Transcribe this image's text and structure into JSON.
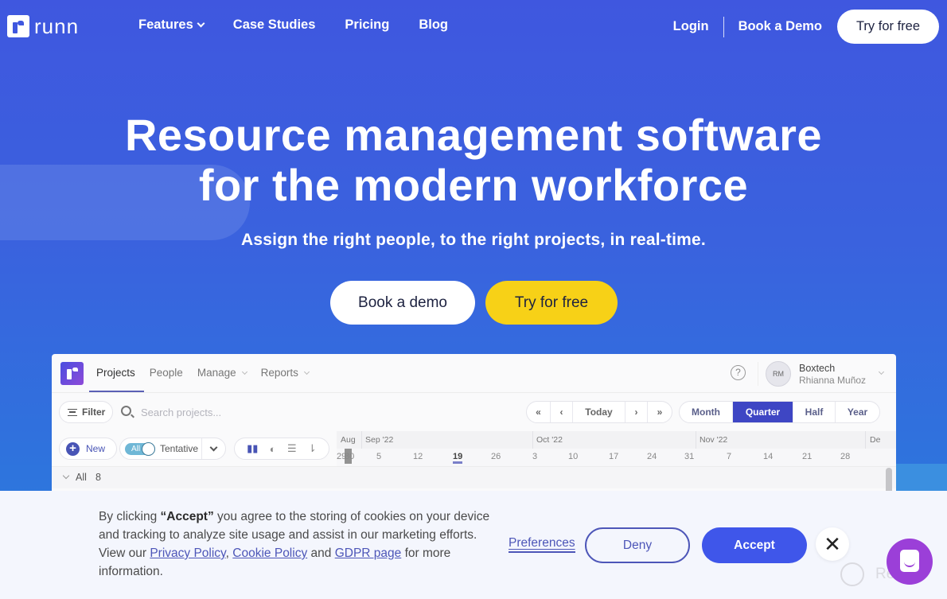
{
  "nav": {
    "logo_text": "runn",
    "links": [
      "Features",
      "Case Studies",
      "Pricing",
      "Blog"
    ],
    "login": "Login",
    "book_demo": "Book a Demo",
    "try_free": "Try for free"
  },
  "hero": {
    "title_line1": "Resource management software",
    "title_line2": "for the modern workforce",
    "subtitle": "Assign the right people, to the right projects, in real-time.",
    "cta_demo": "Book a demo",
    "cta_free": "Try for free"
  },
  "app": {
    "tabs": [
      "Projects",
      "People",
      "Manage",
      "Reports"
    ],
    "active_tab": "Projects",
    "help": "?",
    "avatar_initials": "RM",
    "org": "Boxtech",
    "user": "Rhianna Muñoz",
    "filter_label": "Filter",
    "search_placeholder": "Search projects...",
    "nav_buttons": [
      "«",
      "‹",
      "Today",
      "›",
      "»"
    ],
    "ranges": [
      "Month",
      "Quarter",
      "Half",
      "Year"
    ],
    "selected_range": "Quarter",
    "new_label": "New",
    "toggle_label": "All",
    "tentative_label": "Tentative",
    "months": [
      "Aug",
      "Sep '22",
      "Oct '22",
      "Nov '22",
      "De"
    ],
    "days": [
      "29",
      "30",
      "5",
      "12",
      "19",
      "26",
      "3",
      "10",
      "17",
      "24",
      "31",
      "7",
      "14",
      "21",
      "28"
    ],
    "today_day": "19",
    "group_label": "All",
    "group_count": "8"
  },
  "cookie": {
    "text_before": "By clicking ",
    "accept_quote": "“Accept”",
    "text_after": " you agree to the storing of cookies on your device and tracking to analyze site usage and assist in our marketing efforts. View our ",
    "privacy_link": "Privacy Policy",
    "comma": ", ",
    "cookie_link": "Cookie Policy",
    "and": " and ",
    "gdpr_link": "GDPR page",
    "text_end": " for more information.",
    "preferences": "Preferences",
    "deny": "Deny",
    "accept": "Accept",
    "close": "✕"
  },
  "watermark": "Revain",
  "colors": {
    "brand_blue": "#3f57df",
    "cta_yellow": "#f7d117",
    "accept_blue": "#3f56ea",
    "chat_purple": "#9b3fd8"
  }
}
